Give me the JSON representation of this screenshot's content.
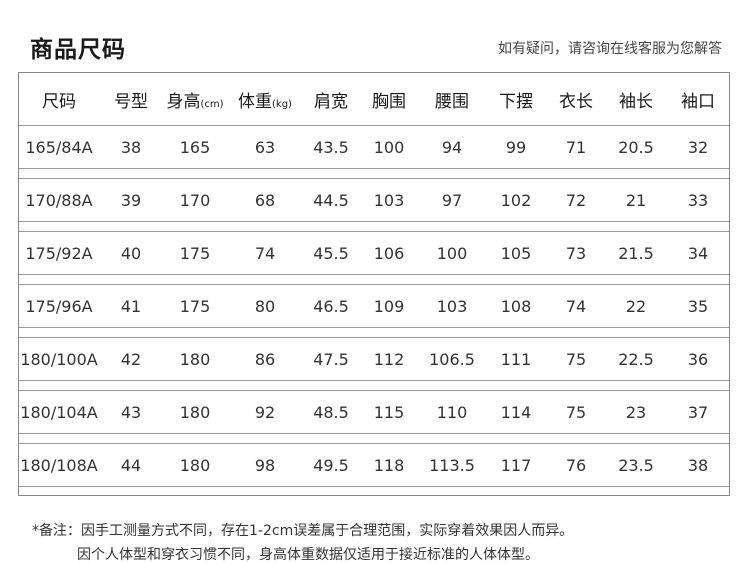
{
  "title": "商品尺码",
  "subtitle": "如有疑问，请咨询在线客服为您解答",
  "table": {
    "headers": [
      {
        "label": "尺码",
        "unit": ""
      },
      {
        "label": "号型",
        "unit": ""
      },
      {
        "label": "身高",
        "unit": "(cm)"
      },
      {
        "label": "体重",
        "unit": "(kg)"
      },
      {
        "label": "肩宽",
        "unit": ""
      },
      {
        "label": "胸围",
        "unit": ""
      },
      {
        "label": "腰围",
        "unit": ""
      },
      {
        "label": "下摆",
        "unit": ""
      },
      {
        "label": "衣长",
        "unit": ""
      },
      {
        "label": "袖长",
        "unit": ""
      },
      {
        "label": "袖口",
        "unit": ""
      }
    ],
    "rows": [
      [
        "165/84A",
        "38",
        "165",
        "63",
        "43.5",
        "100",
        "94",
        "99",
        "71",
        "20.5",
        "32"
      ],
      [
        "170/88A",
        "39",
        "170",
        "68",
        "44.5",
        "103",
        "97",
        "102",
        "72",
        "21",
        "33"
      ],
      [
        "175/92A",
        "40",
        "175",
        "74",
        "45.5",
        "106",
        "100",
        "105",
        "73",
        "21.5",
        "34"
      ],
      [
        "175/96A",
        "41",
        "175",
        "80",
        "46.5",
        "109",
        "103",
        "108",
        "74",
        "22",
        "35"
      ],
      [
        "180/100A",
        "42",
        "180",
        "86",
        "47.5",
        "112",
        "106.5",
        "111",
        "75",
        "22.5",
        "36"
      ],
      [
        "180/104A",
        "43",
        "180",
        "92",
        "48.5",
        "115",
        "110",
        "114",
        "75",
        "23",
        "37"
      ],
      [
        "180/108A",
        "44",
        "180",
        "98",
        "49.5",
        "118",
        "113.5",
        "117",
        "76",
        "23.5",
        "38"
      ]
    ]
  },
  "notes": {
    "line1": "*备注：因手工测量方式不同，存在1-2cm误差属于合理范围，实际穿着效果因人而异。",
    "line2": "因个人体型和穿衣习惯不同，身高体重数据仅适用于接近标准的人体体型。"
  }
}
